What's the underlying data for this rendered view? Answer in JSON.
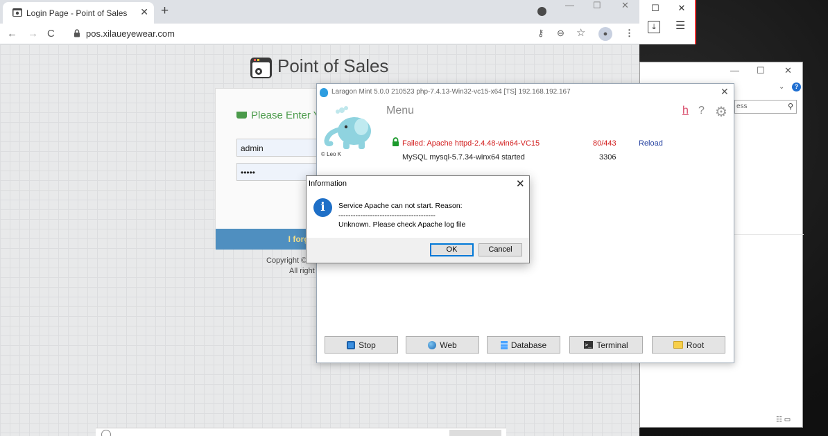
{
  "browser": {
    "tab_title": "Login Page - Point of Sales",
    "url": "pos.xilaueyewear.com"
  },
  "pos_page": {
    "title": "Point of Sales",
    "login_header": "Please Enter Y",
    "username_value": "admin",
    "password_value": "•••••",
    "forgot_label": "I forgo",
    "copyright_line1": "Copyright ©",
    "copyright_line2": "All right"
  },
  "explorer": {
    "search_placeholder": "ess"
  },
  "laragon": {
    "title": "Laragon Mint 5.0.0 210523 php-7.4.13-Win32-vc15-x64 [TS]  192.168.192.167",
    "credit": "© Leo K",
    "menu_label": "Menu",
    "help_letter": "h",
    "question": "?",
    "services": [
      {
        "name": "Failed: Apache httpd-2.4.48-win64-VC15",
        "port": "80/443",
        "action": "Reload",
        "status_color": "#d21d1d"
      },
      {
        "name": "MySQL mysql-5.7.34-winx64 started",
        "port": "3306"
      }
    ],
    "buttons": {
      "stop": "Stop",
      "web": "Web",
      "database": "Database",
      "terminal": "Terminal",
      "root": "Root"
    }
  },
  "dialog": {
    "title": "Information",
    "line1": "Service Apache can not start. Reason:",
    "line2": "----------------------------------------",
    "line3": "Unknown. Please check Apache log file",
    "ok_label": "OK",
    "cancel_label": "Cancel"
  },
  "icons": {
    "accent": "#1e6fc7",
    "error_color": "#d21d1d",
    "link_color": "#223f9f"
  }
}
